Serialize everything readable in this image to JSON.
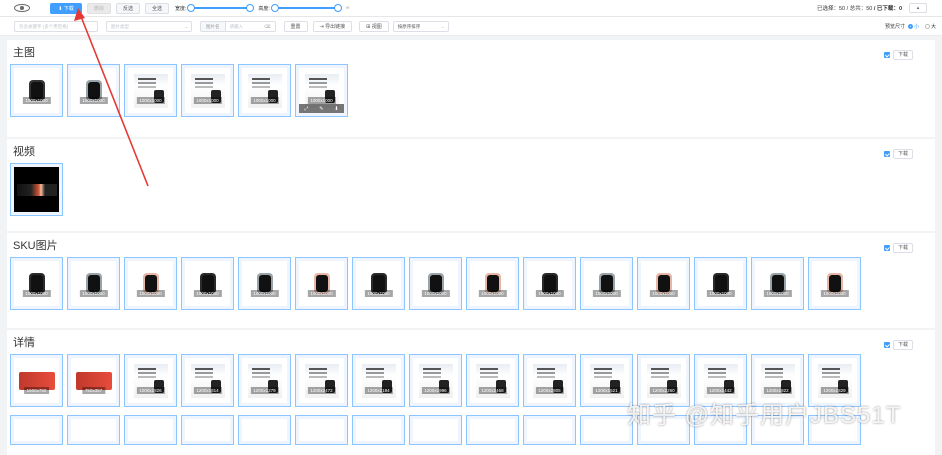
{
  "toolbar": {
    "download_label": "⬇ 下载",
    "disabled_label": "删除",
    "invert_label": "反选",
    "select_all_label": "全选",
    "width_label": "宽度:",
    "height_label": "高度:",
    "slider_max": "∞",
    "selected_label": "已选择：",
    "selected_count": "50",
    "total_label": " / 总共：",
    "total_count": "50",
    "downloaded_label": " / 已下载：",
    "downloaded_count": "0",
    "collapse_icon": "chevron-up-icon"
  },
  "filters": {
    "keyword_placeholder": "包含关键字 (多个用空格)",
    "type_placeholder": "图片类型",
    "compare_prefix": "图片名",
    "compare_placeholder": "请输入",
    "reset_label": "重置",
    "export_label": "⇥ 导出链接",
    "view_label": "⊞ 视图",
    "sort_label": "按原序排序",
    "preview_label": "预览尺寸",
    "size_small": "小",
    "size_large": "大"
  },
  "sections": {
    "main": {
      "title": "主图",
      "download": "下载",
      "items": [
        {
          "dim": "1000x1000",
          "kind": "watch",
          "color": "#333"
        },
        {
          "dim": "1000x1000",
          "kind": "watch",
          "color": "#9aa3a8"
        },
        {
          "dim": "1000x1000",
          "kind": "doc"
        },
        {
          "dim": "1000x1000",
          "kind": "doc"
        },
        {
          "dim": "1000x1000",
          "kind": "doc"
        },
        {
          "dim": "1000x1000",
          "kind": "doc",
          "actions": [
            "⤢",
            "✎",
            "⬇"
          ]
        }
      ]
    },
    "video": {
      "title": "视频",
      "download": "下载"
    },
    "sku": {
      "title": "SKU图片",
      "download": "下载",
      "items": [
        {
          "dim": "1000x1000",
          "color": "#2b2b2b"
        },
        {
          "dim": "1000x1000",
          "color": "#9aa3a8"
        },
        {
          "dim": "1000x1000",
          "color": "#e7b7a6"
        },
        {
          "dim": "1000x1000",
          "color": "#2b2b2b"
        },
        {
          "dim": "1000x1000",
          "color": "#9aa3a8"
        },
        {
          "dim": "1000x1000",
          "color": "#e7b7a6"
        },
        {
          "dim": "1000x1000",
          "color": "#2b2b2b"
        },
        {
          "dim": "1000x1000",
          "color": "#9aa3a8"
        },
        {
          "dim": "1000x1000",
          "color": "#e7b7a6"
        },
        {
          "dim": "1000x1000",
          "color": "#2b2b2b"
        },
        {
          "dim": "1000x1000",
          "color": "#9aa3a8"
        },
        {
          "dim": "1000x1000",
          "color": "#e7b7a6"
        },
        {
          "dim": "1000x1000",
          "color": "#2b2b2b"
        },
        {
          "dim": "1000x1000",
          "color": "#9aa3a8"
        },
        {
          "dim": "1000x1000",
          "color": "#e7b7a6"
        }
      ]
    },
    "detail": {
      "title": "详情",
      "download": "下载",
      "items": [
        {
          "dim": "1600x750",
          "kind": "banner-red"
        },
        {
          "dim": "750x357",
          "kind": "banner-red"
        },
        {
          "dim": "1000x1826",
          "kind": "doc"
        },
        {
          "dim": "1200x1814",
          "kind": "doc"
        },
        {
          "dim": "1200x1279",
          "kind": "doc"
        },
        {
          "dim": "1200x2472",
          "kind": "doc"
        },
        {
          "dim": "1200x2184",
          "kind": "doc"
        },
        {
          "dim": "1200x1996",
          "kind": "doc"
        },
        {
          "dim": "1200x2468",
          "kind": "doc"
        },
        {
          "dim": "1200x2805",
          "kind": "doc"
        },
        {
          "dim": "1200x1521",
          "kind": "doc"
        },
        {
          "dim": "1200x2260",
          "kind": "doc"
        },
        {
          "dim": "1200x1442",
          "kind": "doc"
        },
        {
          "dim": "1200x1822",
          "kind": "doc"
        },
        {
          "dim": "1200x1829",
          "kind": "doc"
        }
      ]
    }
  },
  "watermark": "知乎 @知乎用户JBS51T"
}
